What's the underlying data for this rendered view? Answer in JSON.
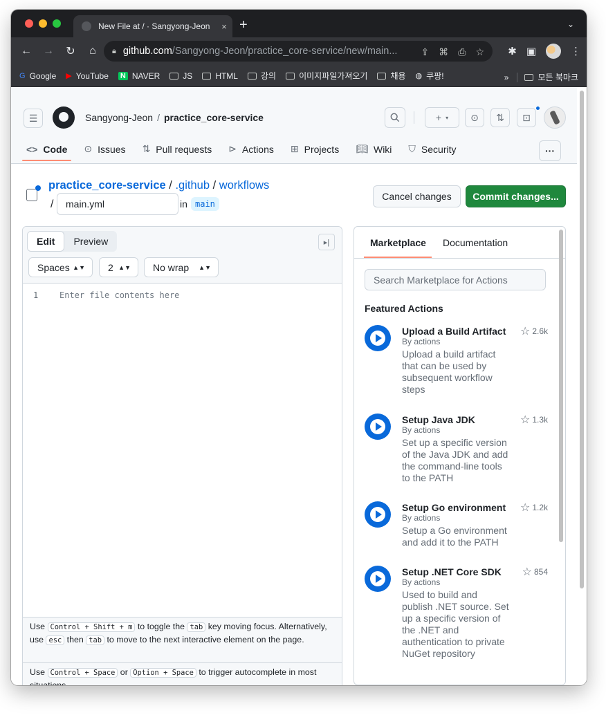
{
  "browser": {
    "tab_title": "New File at / · Sangyong-Jeon",
    "tab_close": "×",
    "new_tab": "+",
    "tab_menu": "⌄",
    "url_host": "github.com",
    "url_path": "/Sangyong-Jeon/practice_core-service/new/main...",
    "bookmarks": [
      "Google",
      "YouTube",
      "NAVER",
      "JS",
      "HTML",
      "강의",
      "이미지파일가져오기",
      "채용",
      "쿠팡!"
    ],
    "bookmarks_overflow": "»",
    "all_bookmarks": "모든 북마크"
  },
  "header": {
    "owner": "Sangyong-Jeon",
    "separator": "/",
    "repo": "practice_core-service"
  },
  "repo_nav": [
    {
      "label": "Code",
      "icon": "code-icon"
    },
    {
      "label": "Issues",
      "icon": "issue-icon"
    },
    {
      "label": "Pull requests",
      "icon": "pull-request-icon"
    },
    {
      "label": "Actions",
      "icon": "play-icon"
    },
    {
      "label": "Projects",
      "icon": "table-icon"
    },
    {
      "label": "Wiki",
      "icon": "book-icon"
    },
    {
      "label": "Security",
      "icon": "shield-icon"
    }
  ],
  "more_label": "···",
  "path": {
    "repo": "practice_core-service",
    "sep1": " / ",
    "folder1": ".github",
    "sep2": " / ",
    "folder2": "workflows",
    "slash": "/",
    "filename": "main.yml",
    "in_label": "in",
    "branch": "main"
  },
  "actions": {
    "cancel": "Cancel changes",
    "commit": "Commit changes..."
  },
  "editor": {
    "edit_tab": "Edit",
    "preview_tab": "Preview",
    "indent_mode": "Spaces",
    "indent_size": "2",
    "wrap_mode": "No wrap",
    "line_number": "1",
    "placeholder": "Enter file contents here",
    "hint1": {
      "use": "Use",
      "key1": "Control + Shift + m",
      "mid": "to toggle the",
      "key2": "tab",
      "after": "key moving focus. Alternatively, use",
      "key3": "esc",
      "then": "then",
      "key4": "tab",
      "end": "to move to the next interactive element on the page."
    },
    "hint2": {
      "use": "Use",
      "key1": "Control + Space",
      "or": "or",
      "key2": "Option + Space",
      "end": "to trigger autocomplete in most situations."
    }
  },
  "sidebar": {
    "tab_marketplace": "Marketplace",
    "tab_docs": "Documentation",
    "search_placeholder": "Search Marketplace for Actions",
    "featured_heading": "Featured Actions",
    "items": [
      {
        "title": "Upload a Build Artifact",
        "by": "By actions",
        "desc": "Upload a build artifact that can be used by subsequent workflow steps",
        "stars": "2.6k"
      },
      {
        "title": "Setup Java JDK",
        "by": "By actions",
        "desc": "Set up a specific version of the Java JDK and add the command-line tools to the PATH",
        "stars": "1.3k"
      },
      {
        "title": "Setup Go environment",
        "by": "By actions",
        "desc": "Setup a Go environment and add it to the PATH",
        "stars": "1.2k"
      },
      {
        "title": "Setup .NET Core SDK",
        "by": "By actions",
        "desc": "Used to build and publish .NET source. Set up a specific version of the .NET and authentication to private NuGet repository",
        "stars": "854"
      }
    ]
  }
}
